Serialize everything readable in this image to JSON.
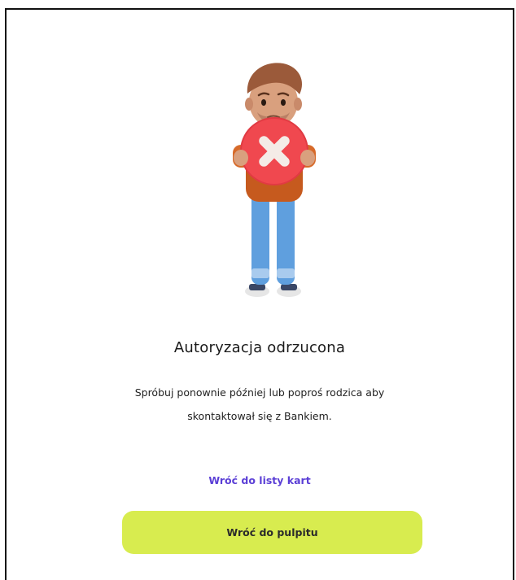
{
  "status": {
    "title": "Autoryzacja odrzucona",
    "description_line1": "Spróbuj ponownie później lub poproś rodzica aby",
    "description_line2": "skontaktował się z Bankiem."
  },
  "actions": {
    "back_to_cards_label": "Wróć do listy kart",
    "back_to_dashboard_label": "Wróć do pulpitu"
  },
  "illustration": {
    "icon": "rejected-person-with-x-sign-icon"
  },
  "colors": {
    "accent_link": "#5b3fd6",
    "primary_button": "#d8ec4f",
    "reject_circle": "#f0484f"
  }
}
